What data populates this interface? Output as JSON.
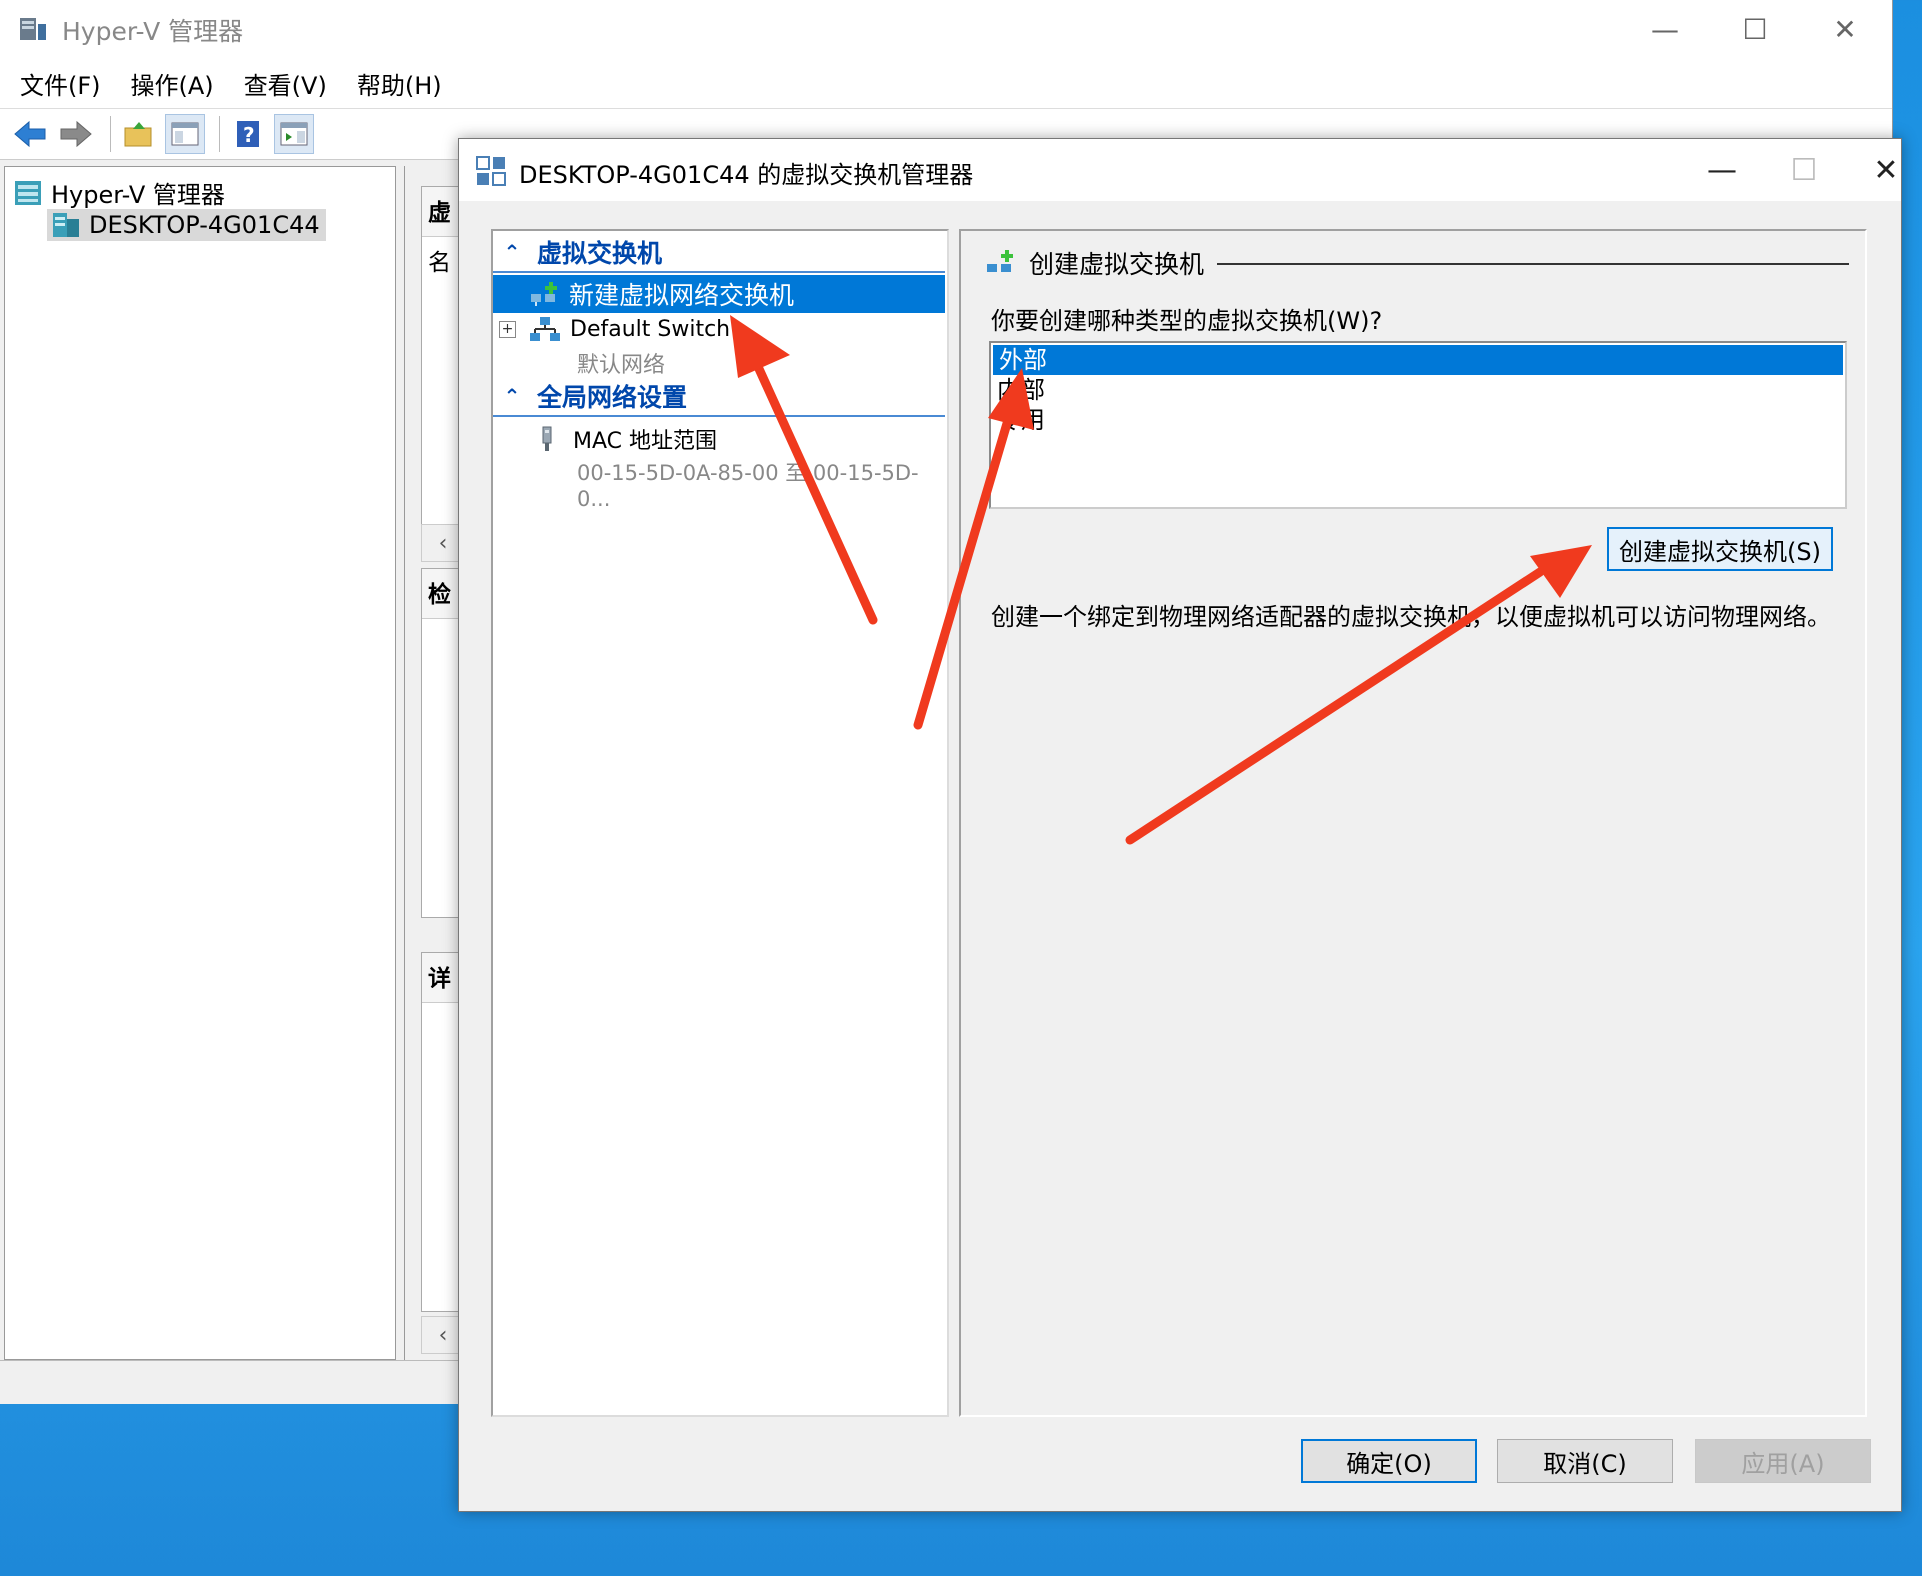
{
  "main_window": {
    "title": "Hyper-V 管理器",
    "menu": [
      "文件(F)",
      "操作(A)",
      "查看(V)",
      "帮助(H)"
    ],
    "tree": {
      "root": "Hyper-V 管理器",
      "host": "DESKTOP-4G01C44"
    },
    "mid_headers": [
      "虚",
      "名",
      "检",
      "详"
    ]
  },
  "dialog": {
    "title": "DESKTOP-4G01C44 的虚拟交换机管理器",
    "nav": {
      "section_switches": "虚拟交换机",
      "new_switch": "新建虚拟网络交换机",
      "default_switch": "Default Switch",
      "default_switch_sub": "默认网络",
      "section_global": "全局网络设置",
      "mac_range": "MAC 地址范围",
      "mac_range_value": "00-15-5D-0A-85-00 至 00-15-5D-0..."
    },
    "detail": {
      "heading": "创建虚拟交换机",
      "question": "你要创建哪种类型的虚拟交换机(W)?",
      "types": [
        "外部",
        "内部",
        "专用"
      ],
      "selected_type": "外部",
      "create_button": "创建虚拟交换机(S)",
      "description": "创建一个绑定到物理网络适配器的虚拟交换机，以便虚拟机可以访问物理网络。"
    },
    "buttons": {
      "ok": "确定(O)",
      "cancel": "取消(C)",
      "apply": "应用(A)"
    }
  },
  "colors": {
    "selection": "#0078d7",
    "section_text": "#0047ab",
    "annotation_arrow": "#f03a1e",
    "desktop": "#1b8fe0"
  }
}
